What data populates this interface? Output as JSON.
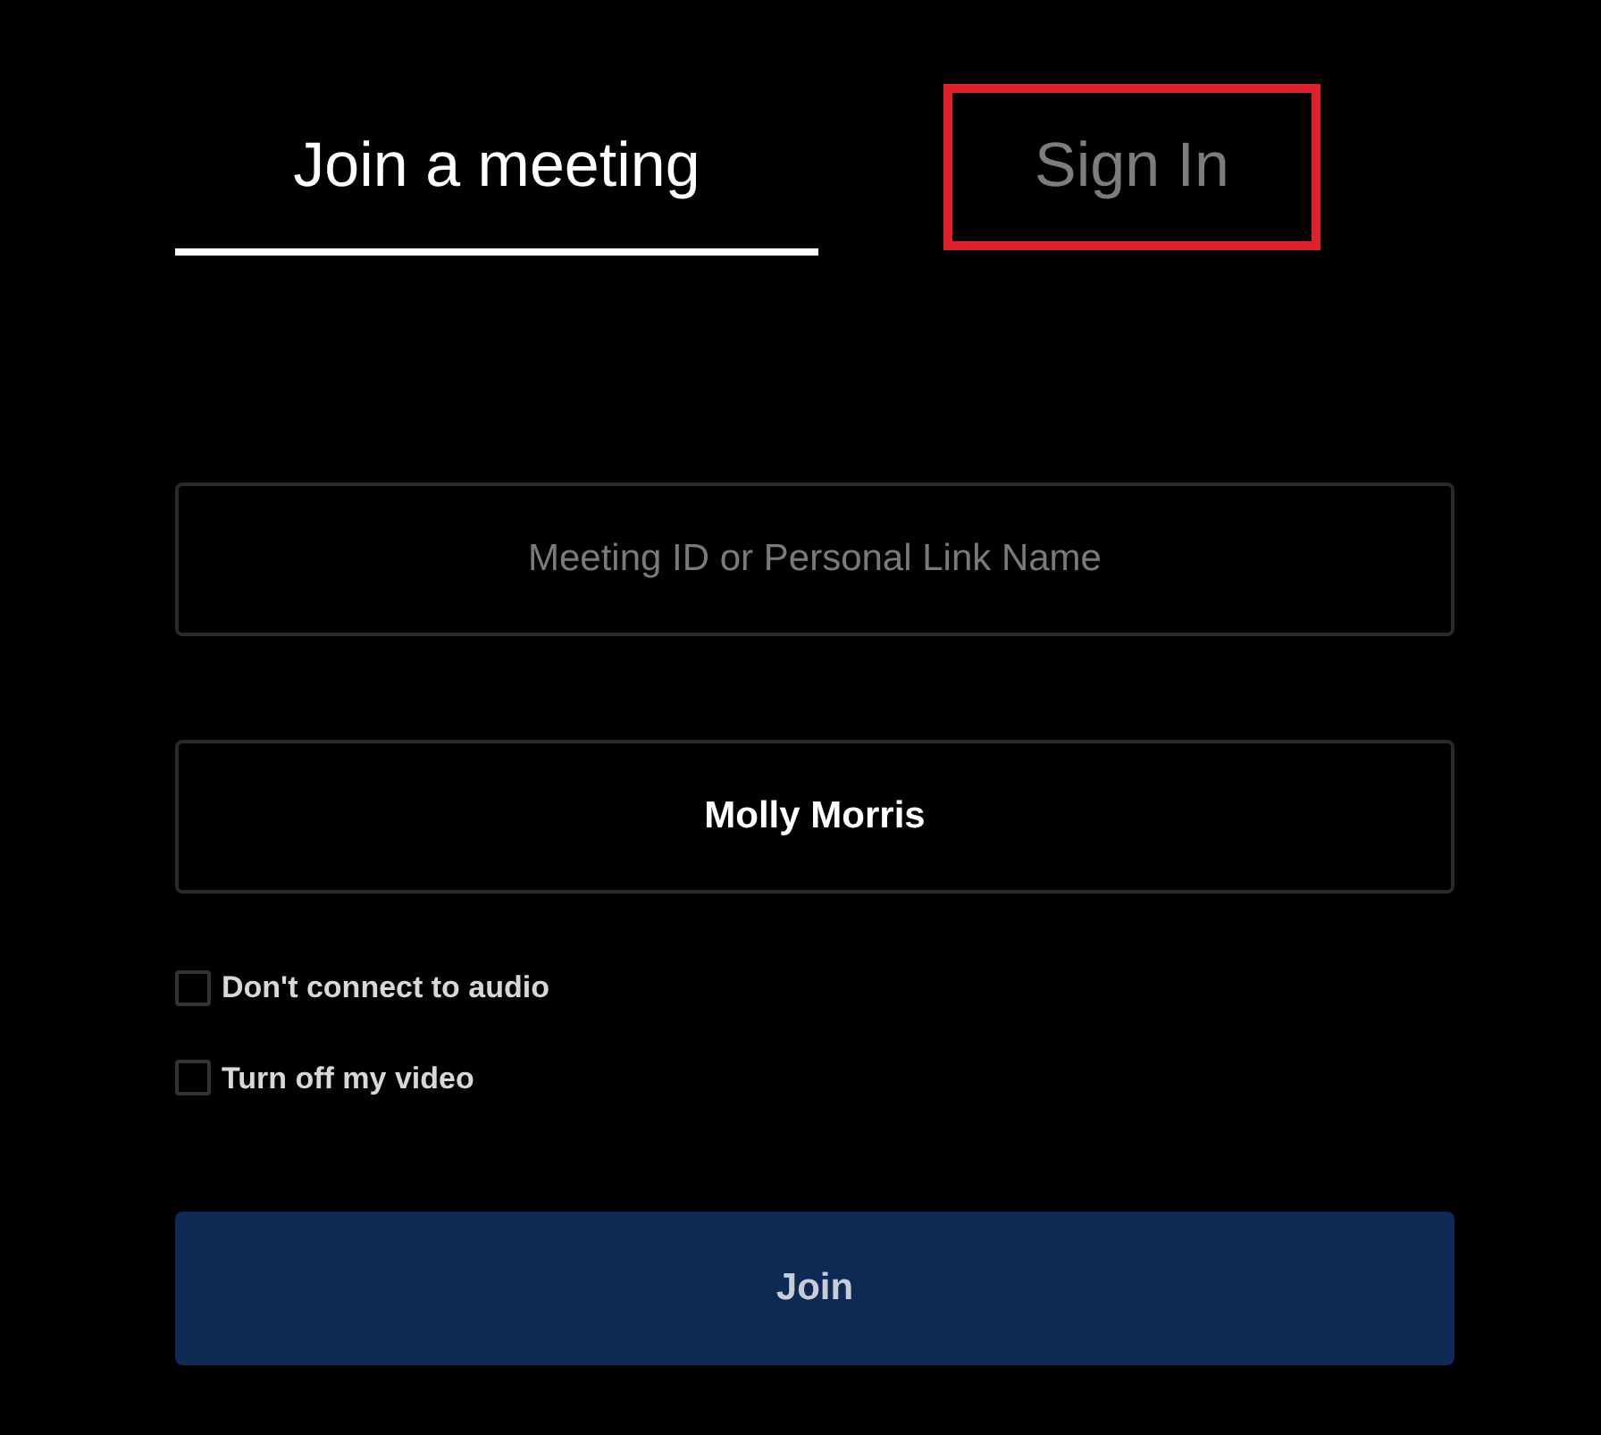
{
  "tabs": [
    {
      "label": "Join a meeting",
      "selected": true,
      "highlighted": false
    },
    {
      "label": "Sign In",
      "selected": false,
      "highlighted": true
    }
  ],
  "fields": [
    {
      "placeholder": "Meeting ID or Personal Link Name"
    },
    {
      "value": "Molly Morris"
    }
  ],
  "options": [
    {
      "label": "Don't connect to audio",
      "checked": false
    },
    {
      "label": "Turn off my video",
      "checked": false
    }
  ],
  "join_button": {
    "label": "Join"
  }
}
